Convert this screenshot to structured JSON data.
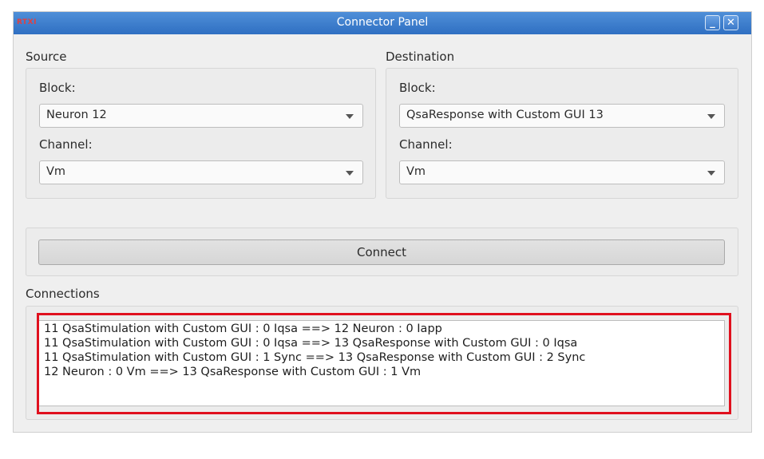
{
  "window": {
    "app_icon_text": "RTXI",
    "title": "Connector Panel",
    "minimize_icon": "_",
    "close_icon": "✕"
  },
  "source": {
    "label": "Source",
    "block_label": "Block:",
    "block_value": "Neuron 12",
    "channel_label": "Channel:",
    "channel_value": "Vm"
  },
  "destination": {
    "label": "Destination",
    "block_label": "Block:",
    "block_value": "QsaResponse with Custom GUI 13",
    "channel_label": "Channel:",
    "channel_value": "Vm"
  },
  "connect_button": "Connect",
  "connections": {
    "label": "Connections",
    "items": [
      "11 QsaStimulation with Custom GUI : 0 Iqsa ==> 12 Neuron : 0 Iapp",
      "11 QsaStimulation with Custom GUI : 0 Iqsa ==> 13 QsaResponse with Custom GUI : 0 Iqsa",
      "11 QsaStimulation with Custom GUI : 1 Sync ==> 13 QsaResponse with Custom GUI : 2 Sync",
      "12 Neuron : 0 Vm ==> 13 QsaResponse with Custom GUI : 1 Vm"
    ]
  },
  "colors": {
    "titlebar": "#3b79c9",
    "highlight": "#e0101e"
  }
}
